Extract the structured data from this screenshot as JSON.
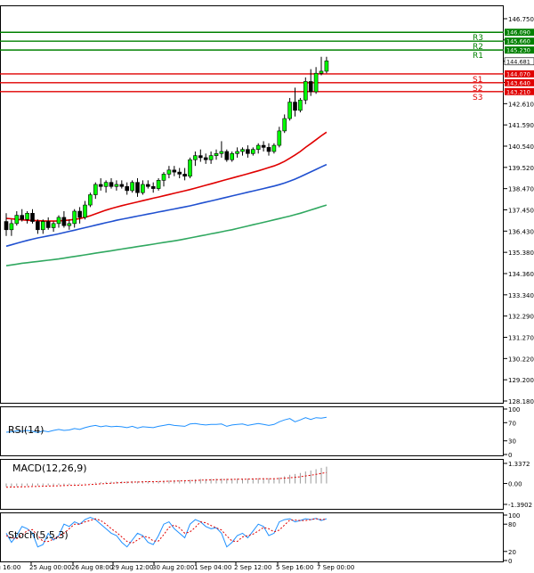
{
  "chart_data": {
    "type": "candlestick",
    "price_axis": {
      "ticks": [
        "146.750",
        "145.720",
        "144.681",
        "143.670",
        "142.610",
        "141.590",
        "140.540",
        "139.520",
        "138.470",
        "137.450",
        "136.430",
        "135.380",
        "134.360",
        "133.340",
        "132.290",
        "131.270",
        "130.220",
        "129.200",
        "128.180"
      ],
      "ylim": [
        128.18,
        146.75
      ]
    },
    "time_axis": {
      "labels": [
        "ug 16:00",
        "25 Aug 00:00",
        "26 Aug 08:00",
        "29 Aug 12:00",
        "30 Aug 20:00",
        "1 Sep 04:00",
        "2 Sep 12:00",
        "5 Sep 16:00",
        "7 Sep 00:00"
      ]
    },
    "current_price": "144.681",
    "levels": [
      {
        "name": "R3",
        "value": 146.09,
        "label": "146.090",
        "color": "#008000"
      },
      {
        "name": "R2",
        "value": 145.66,
        "label": "145.660",
        "color": "#008000"
      },
      {
        "name": "R1",
        "value": 145.23,
        "label": "145.230",
        "color": "#008000"
      },
      {
        "name": "S1",
        "value": 144.07,
        "label": "144.070",
        "color": "#e00000"
      },
      {
        "name": "S2",
        "value": 143.64,
        "label": "143.640",
        "color": "#e00000"
      },
      {
        "name": "S3",
        "value": 143.21,
        "label": "143.210",
        "color": "#e00000"
      }
    ],
    "candles": [
      {
        "o": 136.9,
        "h": 137.3,
        "l": 136.2,
        "c": 136.5
      },
      {
        "o": 136.5,
        "h": 137.0,
        "l": 136.2,
        "c": 136.8
      },
      {
        "o": 136.8,
        "h": 137.4,
        "l": 136.7,
        "c": 137.2
      },
      {
        "o": 137.2,
        "h": 137.5,
        "l": 136.9,
        "c": 137.0
      },
      {
        "o": 137.0,
        "h": 137.4,
        "l": 136.8,
        "c": 137.3
      },
      {
        "o": 137.3,
        "h": 137.5,
        "l": 136.8,
        "c": 136.9
      },
      {
        "o": 136.9,
        "h": 137.0,
        "l": 136.3,
        "c": 136.5
      },
      {
        "o": 136.5,
        "h": 137.0,
        "l": 136.3,
        "c": 136.9
      },
      {
        "o": 136.9,
        "h": 137.1,
        "l": 136.5,
        "c": 136.6
      },
      {
        "o": 136.6,
        "h": 136.9,
        "l": 136.4,
        "c": 136.8
      },
      {
        "o": 136.8,
        "h": 137.2,
        "l": 136.6,
        "c": 137.1
      },
      {
        "o": 137.1,
        "h": 137.4,
        "l": 136.6,
        "c": 136.7
      },
      {
        "o": 136.7,
        "h": 137.0,
        "l": 136.5,
        "c": 136.8
      },
      {
        "o": 136.8,
        "h": 137.5,
        "l": 136.6,
        "c": 137.4
      },
      {
        "o": 137.4,
        "h": 137.6,
        "l": 136.8,
        "c": 137.1
      },
      {
        "o": 137.1,
        "h": 137.9,
        "l": 137.0,
        "c": 137.7
      },
      {
        "o": 137.7,
        "h": 138.3,
        "l": 137.6,
        "c": 138.2
      },
      {
        "o": 138.2,
        "h": 138.8,
        "l": 138.0,
        "c": 138.7
      },
      {
        "o": 138.7,
        "h": 139.0,
        "l": 138.4,
        "c": 138.6
      },
      {
        "o": 138.6,
        "h": 138.9,
        "l": 138.3,
        "c": 138.8
      },
      {
        "o": 138.8,
        "h": 139.0,
        "l": 138.5,
        "c": 138.6
      },
      {
        "o": 138.6,
        "h": 138.9,
        "l": 138.4,
        "c": 138.7
      },
      {
        "o": 138.7,
        "h": 138.9,
        "l": 138.5,
        "c": 138.6
      },
      {
        "o": 138.6,
        "h": 138.8,
        "l": 138.2,
        "c": 138.4
      },
      {
        "o": 138.4,
        "h": 138.9,
        "l": 138.3,
        "c": 138.8
      },
      {
        "o": 138.8,
        "h": 139.0,
        "l": 138.1,
        "c": 138.3
      },
      {
        "o": 138.3,
        "h": 138.9,
        "l": 138.2,
        "c": 138.7
      },
      {
        "o": 138.7,
        "h": 138.9,
        "l": 138.5,
        "c": 138.6
      },
      {
        "o": 138.6,
        "h": 138.8,
        "l": 138.3,
        "c": 138.5
      },
      {
        "o": 138.5,
        "h": 139.0,
        "l": 138.4,
        "c": 138.9
      },
      {
        "o": 138.9,
        "h": 139.3,
        "l": 138.6,
        "c": 139.2
      },
      {
        "o": 139.2,
        "h": 139.6,
        "l": 139.0,
        "c": 139.4
      },
      {
        "o": 139.4,
        "h": 139.6,
        "l": 139.1,
        "c": 139.3
      },
      {
        "o": 139.3,
        "h": 139.5,
        "l": 139.0,
        "c": 139.2
      },
      {
        "o": 139.2,
        "h": 139.5,
        "l": 138.9,
        "c": 139.1
      },
      {
        "o": 139.1,
        "h": 140.0,
        "l": 139.0,
        "c": 139.9
      },
      {
        "o": 139.9,
        "h": 140.3,
        "l": 139.6,
        "c": 140.1
      },
      {
        "o": 140.1,
        "h": 140.4,
        "l": 139.8,
        "c": 140.0
      },
      {
        "o": 140.0,
        "h": 140.2,
        "l": 139.7,
        "c": 139.9
      },
      {
        "o": 139.9,
        "h": 140.3,
        "l": 139.7,
        "c": 140.1
      },
      {
        "o": 140.1,
        "h": 140.4,
        "l": 139.9,
        "c": 140.2
      },
      {
        "o": 140.2,
        "h": 140.8,
        "l": 140.0,
        "c": 140.3
      },
      {
        "o": 140.3,
        "h": 140.4,
        "l": 139.8,
        "c": 139.9
      },
      {
        "o": 139.9,
        "h": 140.3,
        "l": 139.8,
        "c": 140.2
      },
      {
        "o": 140.2,
        "h": 140.5,
        "l": 140.0,
        "c": 140.3
      },
      {
        "o": 140.3,
        "h": 140.5,
        "l": 140.1,
        "c": 140.4
      },
      {
        "o": 140.4,
        "h": 140.6,
        "l": 140.0,
        "c": 140.2
      },
      {
        "o": 140.2,
        "h": 140.5,
        "l": 140.1,
        "c": 140.4
      },
      {
        "o": 140.4,
        "h": 140.7,
        "l": 140.2,
        "c": 140.6
      },
      {
        "o": 140.6,
        "h": 140.8,
        "l": 140.3,
        "c": 140.5
      },
      {
        "o": 140.5,
        "h": 140.7,
        "l": 140.1,
        "c": 140.3
      },
      {
        "o": 140.3,
        "h": 140.7,
        "l": 140.2,
        "c": 140.6
      },
      {
        "o": 140.6,
        "h": 141.5,
        "l": 140.5,
        "c": 141.3
      },
      {
        "o": 141.3,
        "h": 142.1,
        "l": 141.2,
        "c": 141.9
      },
      {
        "o": 141.9,
        "h": 142.9,
        "l": 141.8,
        "c": 142.7
      },
      {
        "o": 142.7,
        "h": 143.4,
        "l": 142.0,
        "c": 142.3
      },
      {
        "o": 142.3,
        "h": 142.9,
        "l": 142.2,
        "c": 142.8
      },
      {
        "o": 142.8,
        "h": 143.9,
        "l": 142.6,
        "c": 143.7
      },
      {
        "o": 143.7,
        "h": 144.3,
        "l": 143.0,
        "c": 143.2
      },
      {
        "o": 143.2,
        "h": 144.4,
        "l": 143.1,
        "c": 144.1
      },
      {
        "o": 144.1,
        "h": 144.9,
        "l": 144.0,
        "c": 144.2
      },
      {
        "o": 144.2,
        "h": 144.9,
        "l": 144.1,
        "c": 144.7
      }
    ],
    "moving_averages": [
      {
        "color": "#e00000",
        "values": [
          137.05,
          137.03,
          137.0,
          136.98,
          136.96,
          136.95,
          136.94,
          136.93,
          136.92,
          136.92,
          136.93,
          136.95,
          136.97,
          137.0,
          137.04,
          137.1,
          137.18,
          137.27,
          137.36,
          137.45,
          137.53,
          137.6,
          137.67,
          137.73,
          137.79,
          137.85,
          137.91,
          137.97,
          138.03,
          138.09,
          138.15,
          138.21,
          138.27,
          138.33,
          138.39,
          138.45,
          138.52,
          138.59,
          138.66,
          138.73,
          138.8,
          138.87,
          138.94,
          139.01,
          139.08,
          139.15,
          139.22,
          139.29,
          139.36,
          139.44,
          139.52,
          139.6,
          139.7,
          139.82,
          139.97,
          140.13,
          140.3,
          140.5,
          140.68,
          140.87,
          141.06,
          141.24
        ]
      },
      {
        "color": "#2050d0",
        "values": [
          135.7,
          135.77,
          135.84,
          135.91,
          135.98,
          136.04,
          136.1,
          136.15,
          136.2,
          136.25,
          136.3,
          136.36,
          136.42,
          136.48,
          136.54,
          136.6,
          136.66,
          136.72,
          136.78,
          136.84,
          136.9,
          136.96,
          137.01,
          137.06,
          137.11,
          137.16,
          137.21,
          137.26,
          137.31,
          137.36,
          137.41,
          137.46,
          137.51,
          137.56,
          137.61,
          137.66,
          137.72,
          137.78,
          137.84,
          137.9,
          137.96,
          138.02,
          138.08,
          138.14,
          138.2,
          138.26,
          138.32,
          138.38,
          138.44,
          138.5,
          138.56,
          138.62,
          138.69,
          138.77,
          138.86,
          138.96,
          139.07,
          139.19,
          139.31,
          139.43,
          139.55,
          139.67
        ]
      },
      {
        "color": "#30a860",
        "values": [
          134.75,
          134.79,
          134.83,
          134.87,
          134.9,
          134.93,
          134.96,
          134.99,
          135.02,
          135.05,
          135.08,
          135.12,
          135.16,
          135.2,
          135.24,
          135.28,
          135.32,
          135.36,
          135.4,
          135.44,
          135.48,
          135.52,
          135.56,
          135.6,
          135.64,
          135.68,
          135.72,
          135.76,
          135.8,
          135.84,
          135.88,
          135.92,
          135.96,
          136.0,
          136.05,
          136.1,
          136.15,
          136.2,
          136.25,
          136.3,
          136.35,
          136.4,
          136.45,
          136.5,
          136.56,
          136.62,
          136.68,
          136.74,
          136.8,
          136.86,
          136.92,
          136.98,
          137.04,
          137.1,
          137.16,
          137.23,
          137.3,
          137.38,
          137.46,
          137.54,
          137.62,
          137.7
        ]
      }
    ],
    "rsi": {
      "label": "RSI(14)",
      "ticks": [
        "100",
        "70",
        "30",
        "0"
      ],
      "values": [
        49,
        50,
        52,
        51,
        53,
        51,
        48,
        52,
        50,
        53,
        55,
        53,
        54,
        57,
        55,
        59,
        62,
        64,
        61,
        63,
        61,
        62,
        61,
        59,
        62,
        58,
        61,
        60,
        59,
        62,
        64,
        66,
        64,
        63,
        62,
        67,
        68,
        66,
        65,
        66,
        66,
        67,
        62,
        65,
        66,
        67,
        64,
        66,
        68,
        66,
        64,
        66,
        72,
        76,
        79,
        72,
        76,
        81,
        77,
        81,
        80,
        82
      ]
    },
    "macd": {
      "label": "MACD(12,26,9)",
      "ticks": [
        "1.3372",
        "0.00",
        "-1.3902"
      ],
      "histogram": [
        -0.22,
        -0.2,
        -0.18,
        -0.17,
        -0.15,
        -0.14,
        -0.14,
        -0.13,
        -0.13,
        -0.12,
        -0.1,
        -0.1,
        -0.09,
        -0.06,
        -0.05,
        -0.02,
        0.02,
        0.07,
        0.09,
        0.11,
        0.12,
        0.13,
        0.14,
        0.14,
        0.15,
        0.14,
        0.15,
        0.15,
        0.15,
        0.16,
        0.18,
        0.2,
        0.21,
        0.22,
        0.22,
        0.25,
        0.28,
        0.3,
        0.3,
        0.31,
        0.32,
        0.33,
        0.32,
        0.32,
        0.33,
        0.33,
        0.33,
        0.34,
        0.35,
        0.35,
        0.35,
        0.35,
        0.4,
        0.48,
        0.58,
        0.63,
        0.7,
        0.8,
        0.86,
        0.95,
        1.04,
        1.12
      ],
      "signal": [
        -0.25,
        -0.24,
        -0.23,
        -0.22,
        -0.21,
        -0.2,
        -0.19,
        -0.18,
        -0.17,
        -0.16,
        -0.15,
        -0.14,
        -0.13,
        -0.12,
        -0.11,
        -0.09,
        -0.07,
        -0.05,
        -0.02,
        0.0,
        0.02,
        0.04,
        0.06,
        0.08,
        0.09,
        0.1,
        0.11,
        0.12,
        0.12,
        0.13,
        0.14,
        0.15,
        0.16,
        0.17,
        0.18,
        0.19,
        0.2,
        0.22,
        0.23,
        0.24,
        0.25,
        0.26,
        0.27,
        0.27,
        0.28,
        0.29,
        0.29,
        0.3,
        0.31,
        0.31,
        0.32,
        0.32,
        0.33,
        0.35,
        0.38,
        0.41,
        0.45,
        0.5,
        0.55,
        0.61,
        0.67,
        0.73
      ]
    },
    "stoch": {
      "label": "Stoch(5,5,3)",
      "ticks": [
        "100",
        "80",
        "20",
        "0"
      ],
      "main": [
        60,
        40,
        55,
        75,
        70,
        60,
        30,
        35,
        60,
        45,
        55,
        80,
        75,
        85,
        80,
        90,
        95,
        90,
        80,
        70,
        60,
        55,
        40,
        30,
        45,
        60,
        55,
        40,
        35,
        55,
        80,
        85,
        70,
        60,
        50,
        80,
        90,
        85,
        75,
        70,
        72,
        60,
        30,
        40,
        55,
        60,
        50,
        65,
        80,
        75,
        55,
        60,
        85,
        90,
        92,
        85,
        88,
        92,
        90,
        93,
        88,
        92
      ],
      "signal": [
        55,
        50,
        48,
        56,
        66,
        68,
        55,
        42,
        42,
        47,
        53,
        60,
        70,
        80,
        80,
        85,
        88,
        92,
        88,
        80,
        70,
        62,
        52,
        42,
        38,
        45,
        53,
        52,
        43,
        43,
        57,
        73,
        78,
        72,
        60,
        63,
        73,
        85,
        83,
        77,
        72,
        67,
        54,
        43,
        42,
        52,
        55,
        58,
        65,
        73,
        70,
        63,
        67,
        78,
        89,
        89,
        88,
        88,
        90,
        92,
        90,
        91
      ]
    }
  }
}
